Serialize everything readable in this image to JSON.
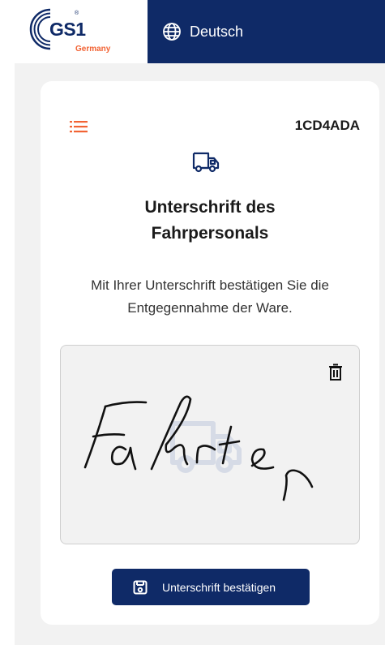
{
  "header": {
    "logo": {
      "brand": "GS1",
      "sub": "Germany",
      "reg": "®",
      "icon": "gs1-logo"
    },
    "language": {
      "label": "Deutsch",
      "icon": "globe-icon"
    },
    "colors": {
      "navy": "#0f2a67",
      "orange": "#f26334"
    }
  },
  "card": {
    "menu_icon": "list-icon",
    "document_id": "1CD4ADA",
    "header_icon": "truck-icon",
    "title": "Unterschrift des Fahrpersonals",
    "description": "Mit Ihrer Unterschrift bestätigen Sie die Entgegennahme der Ware.",
    "signature_pad": {
      "signature_text": "Fahrer",
      "delete_icon": "trash-icon",
      "placeholder_icon": "truck-icon"
    },
    "confirm_button": {
      "label": "Unterschrift bestätigen",
      "icon": "save-icon"
    }
  }
}
